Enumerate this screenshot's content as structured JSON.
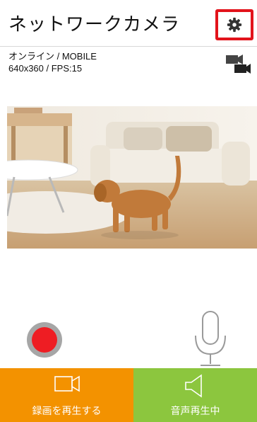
{
  "header": {
    "title": "ネットワークカメラ",
    "settings_icon": "gear-icon"
  },
  "status": {
    "connection": "オンライン / MOBILE",
    "resolution": "640x360 / FPS:15"
  },
  "camera_switch_icon": "camera-switch-icon",
  "controls": {
    "record_icon": "record-icon",
    "record_color": "#ee1d23",
    "mic_icon": "microphone-icon"
  },
  "bottom_bar": {
    "playback_label": "録画を再生する",
    "playback_icon": "video-camera-icon",
    "playback_color": "#f39200",
    "audio_label": "音声再生中",
    "audio_icon": "speaker-icon",
    "audio_color": "#8cc63e"
  }
}
